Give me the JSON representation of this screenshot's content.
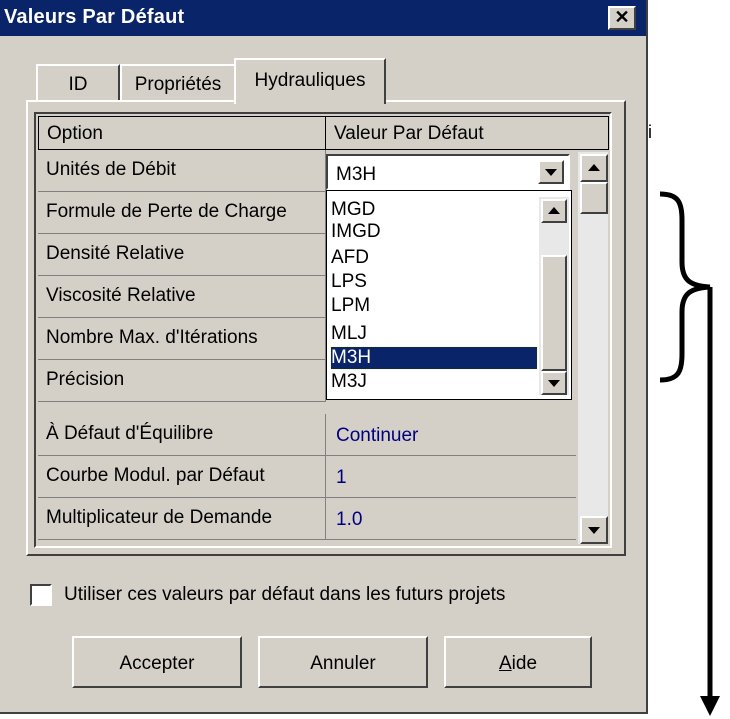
{
  "window": {
    "title": "Valeurs Par Défaut",
    "close_label": "✕"
  },
  "tabs": [
    {
      "label": "ID"
    },
    {
      "label": "Propriétés"
    },
    {
      "label": "Hydrauliques",
      "active": true
    }
  ],
  "grid": {
    "headers": {
      "option": "Option",
      "value": "Valeur Par Défaut"
    },
    "rows": [
      {
        "label": "Unités de Débit",
        "value": "M3H"
      },
      {
        "label": "Formule de Perte de Charge",
        "value": ""
      },
      {
        "label": "Densité Relative",
        "value": ""
      },
      {
        "label": "Viscosité Relative",
        "value": ""
      },
      {
        "label": "Nombre Max. d'Itérations",
        "value": ""
      },
      {
        "label": "Précision",
        "value": ""
      },
      {
        "label": "À Défaut d'Équilibre",
        "value": "Continuer"
      },
      {
        "label": "Courbe Modul. par Défaut",
        "value": "1"
      },
      {
        "label": "Multiplicateur de Demande",
        "value": "1.0"
      }
    ]
  },
  "combo": {
    "selected": "M3H",
    "options": [
      "MGD",
      "IMGD",
      "AFD",
      "LPS",
      "LPM",
      "MLJ",
      "M3H",
      "M3J"
    ],
    "highlighted": "M3H"
  },
  "checkbox": {
    "label": "Utiliser ces valeurs  par défaut dans les futurs projets",
    "checked": false
  },
  "buttons": {
    "accept": "Accepter",
    "cancel": "Annuler",
    "help_prefix": "A",
    "help_rest": "ide"
  },
  "stray_mark": "i",
  "colors": {
    "title_bar": "#0a246a",
    "face": "#d4d0c8",
    "value_text": "#00007f",
    "selection": "#0a246a"
  }
}
